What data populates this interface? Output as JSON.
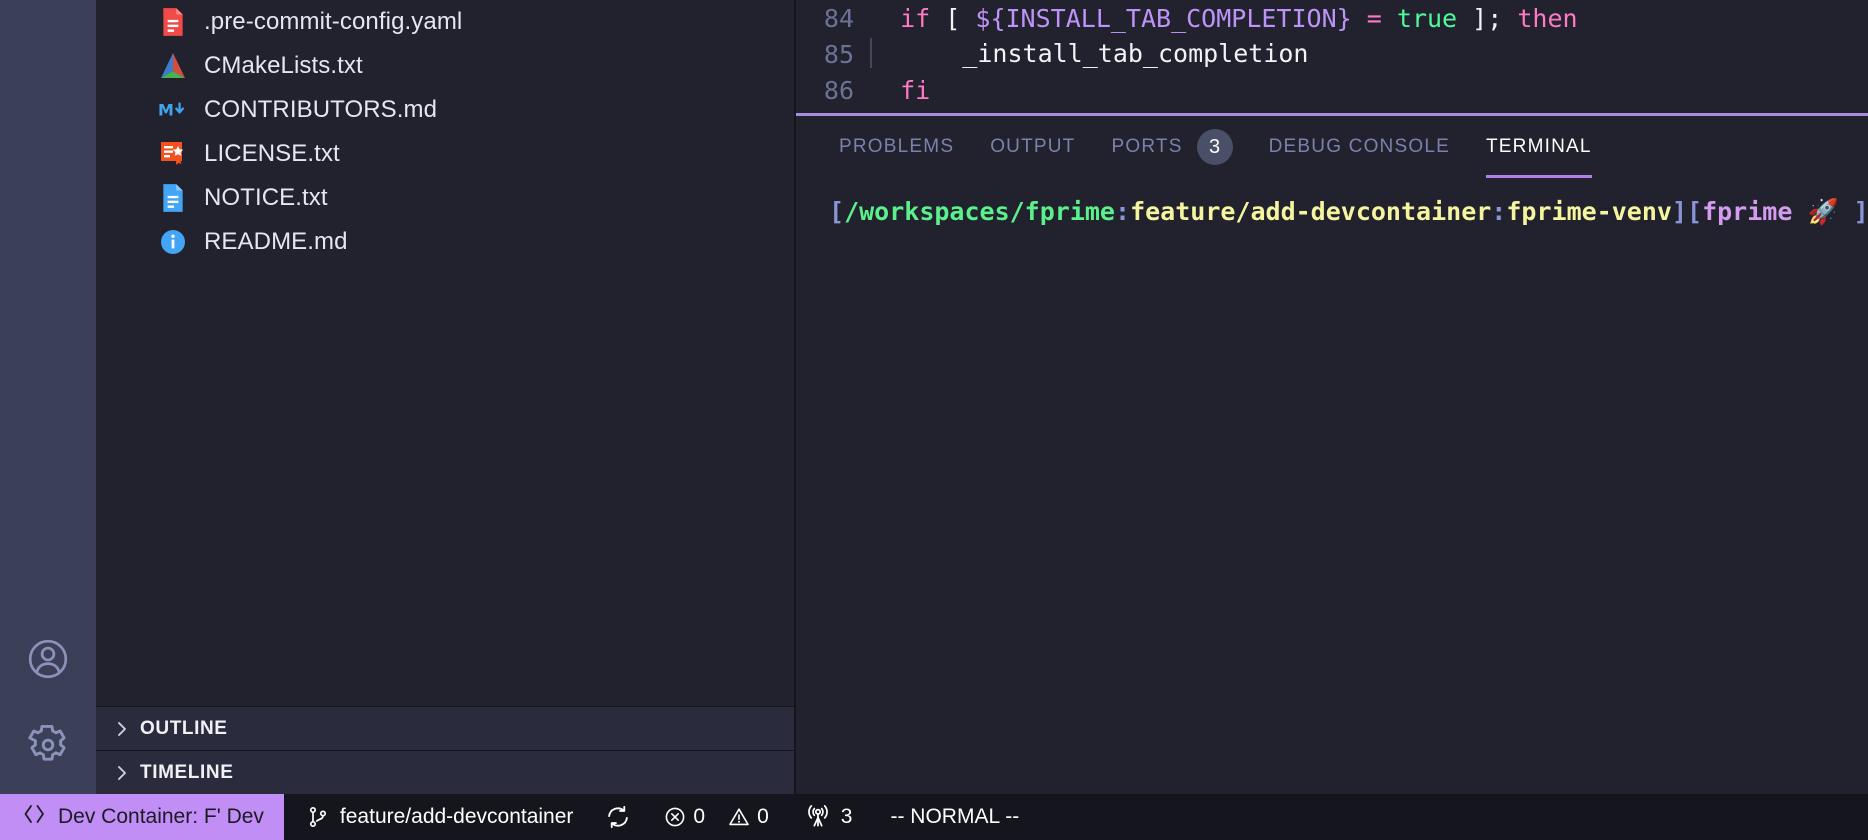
{
  "activity_bar": {
    "items": [
      {
        "name": "accounts",
        "icon": "account-icon"
      },
      {
        "name": "settings",
        "icon": "gear-icon"
      }
    ]
  },
  "sidebar": {
    "files": [
      {
        "label": ".pre-commit-config.yaml",
        "icon": "yaml-file-icon"
      },
      {
        "label": "CMakeLists.txt",
        "icon": "cmake-file-icon"
      },
      {
        "label": "CONTRIBUTORS.md",
        "icon": "markdown-file-icon"
      },
      {
        "label": "LICENSE.txt",
        "icon": "license-file-icon"
      },
      {
        "label": "NOTICE.txt",
        "icon": "text-file-icon"
      },
      {
        "label": "README.md",
        "icon": "info-file-icon"
      }
    ],
    "panes": [
      {
        "label": "OUTLINE",
        "icon": "chevron-right-icon",
        "expanded": false
      },
      {
        "label": "TIMELINE",
        "icon": "chevron-right-icon",
        "expanded": false
      }
    ]
  },
  "editor": {
    "lines": [
      {
        "number": "84",
        "tokens": [
          {
            "text": "  ",
            "kind": "plain"
          },
          {
            "text": "if",
            "kind": "kw"
          },
          {
            "text": " ",
            "kind": "plain"
          },
          {
            "text": "[",
            "kind": "punc"
          },
          {
            "text": " ",
            "kind": "plain"
          },
          {
            "text": "${INSTALL_TAB_COMPLETION}",
            "kind": "var"
          },
          {
            "text": " ",
            "kind": "plain"
          },
          {
            "text": "=",
            "kind": "kw"
          },
          {
            "text": " ",
            "kind": "plain"
          },
          {
            "text": "true",
            "kind": "const"
          },
          {
            "text": " ",
            "kind": "plain"
          },
          {
            "text": "];",
            "kind": "punc"
          },
          {
            "text": " ",
            "kind": "plain"
          },
          {
            "text": "then",
            "kind": "kw"
          }
        ]
      },
      {
        "number": "85",
        "tokens": [
          {
            "text": "      _install_tab_completion",
            "kind": "plain"
          }
        ]
      },
      {
        "number": "86",
        "tokens": [
          {
            "text": "  ",
            "kind": "plain"
          },
          {
            "text": "fi",
            "kind": "kw"
          }
        ]
      }
    ]
  },
  "panel": {
    "tabs": [
      {
        "label": "PROBLEMS",
        "active": false,
        "badge": null
      },
      {
        "label": "OUTPUT",
        "active": false,
        "badge": null
      },
      {
        "label": "PORTS",
        "active": false,
        "badge": "3"
      },
      {
        "label": "DEBUG CONSOLE",
        "active": false,
        "badge": null
      },
      {
        "label": "TERMINAL",
        "active": true,
        "badge": null
      }
    ],
    "terminal": {
      "prompt": {
        "open_bracket": "[",
        "path": "/workspaces/fprime",
        "sep1": ":",
        "branch": "feature/add-devcontainer",
        "sep2": ":",
        "venv": "fprime-venv",
        "close_bracket": "]",
        "open_bracket2": "[",
        "env": "fprime",
        "emoji": "🚀",
        "close_bracket2": "]"
      },
      "input_value": ""
    }
  },
  "status_bar": {
    "remote": {
      "label": "Dev Container: F' Dev",
      "icon": "remote-explorer-icon"
    },
    "branch": {
      "label": "feature/add-devcontainer",
      "icon": "source-control-branch-icon"
    },
    "sync": {
      "icon": "sync-icon"
    },
    "errors": {
      "label": "0",
      "icon": "error-circle-icon"
    },
    "warnings": {
      "label": "0",
      "icon": "warning-triangle-icon"
    },
    "ports": {
      "label": "3",
      "icon": "radio-tower-icon"
    },
    "mode": {
      "label": "-- NORMAL --"
    }
  },
  "colors": {
    "accent": "#b07fe8",
    "remote_bg": "#c08ef5",
    "panel_border": "#a98ee0",
    "terminal_path": "#5bf08c",
    "terminal_branch": "#f5f5a0",
    "terminal_env": "#d49cf0"
  }
}
